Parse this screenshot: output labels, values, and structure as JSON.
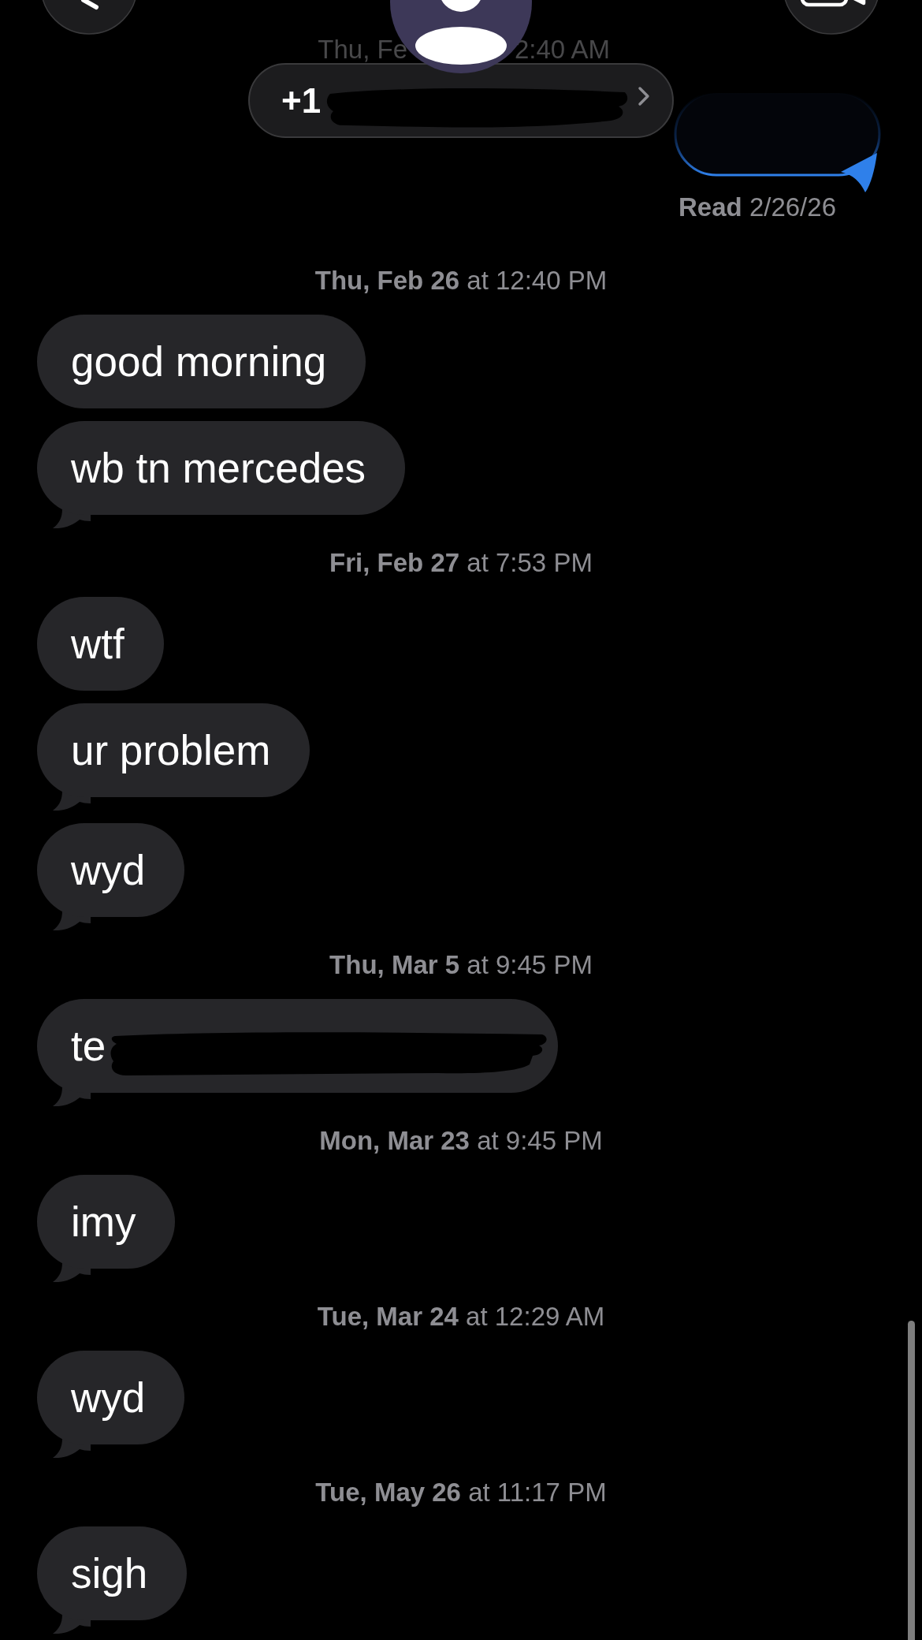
{
  "header": {
    "phone_number": {
      "text": "+1",
      "redacted": true
    }
  },
  "top_timestamp": {
    "start": "Thu, Fe",
    "end": "2:40 AM"
  },
  "sent_message": {
    "receipt": "**Read** 2/26/26"
  },
  "conversation": [
    {
      "timestamp": "**Thu, Feb 26** at 12:40 PM",
      "messages": [
        {
          "text": "good morning",
          "tail": false,
          "redacted": false
        },
        {
          "text": "wb tn mercedes",
          "tail": true,
          "redacted": false
        }
      ]
    },
    {
      "timestamp": "**Fri, Feb 27** at 7:53 PM",
      "messages": [
        {
          "text": "wtf",
          "tail": false,
          "redacted": false
        },
        {
          "text": "ur problem",
          "tail": true,
          "redacted": false
        },
        {
          "text": "wyd",
          "tail": true,
          "redacted": false
        }
      ]
    },
    {
      "timestamp": "**Thu, Mar 5** at 9:45 PM",
      "messages": [
        {
          "text": "te",
          "tail": true,
          "redacted": true
        }
      ]
    },
    {
      "timestamp": "**Mon, Mar 23** at 9:45 PM",
      "messages": [
        {
          "text": "imy",
          "tail": true,
          "redacted": false
        }
      ]
    },
    {
      "timestamp": "**Tue, Mar 24** at 12:29 AM",
      "messages": [
        {
          "text": "wyd",
          "tail": true,
          "redacted": false
        }
      ]
    },
    {
      "timestamp": "**Tue, May 26** at 11:17 PM",
      "messages": [
        {
          "text": "sigh",
          "tail": true,
          "redacted": false
        }
      ]
    }
  ]
}
